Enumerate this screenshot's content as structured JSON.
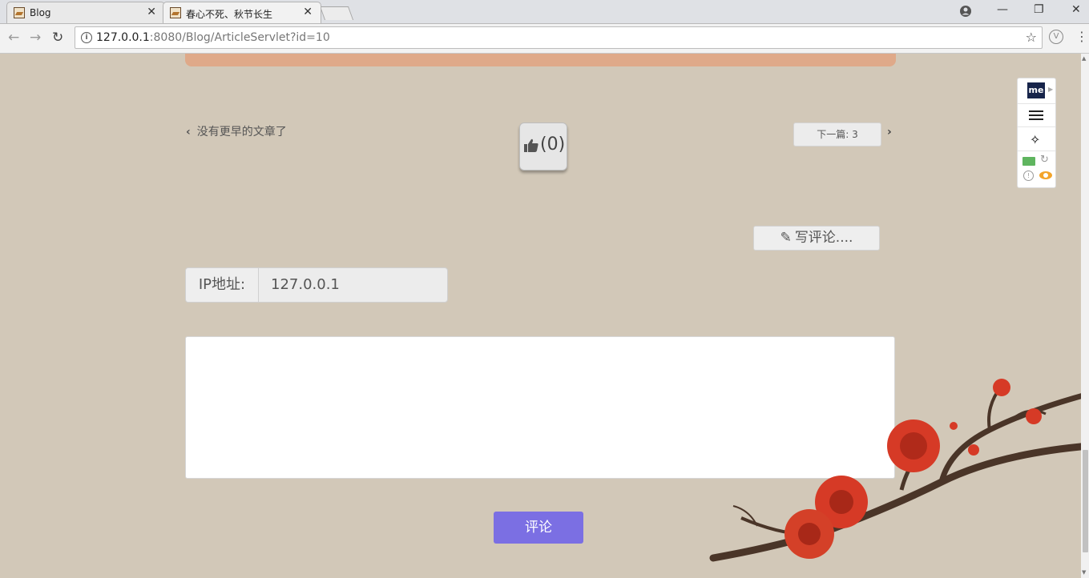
{
  "browser": {
    "tabs": [
      {
        "title": "Blog",
        "active": false
      },
      {
        "title": "春心不死、秋节长生",
        "active": true
      }
    ],
    "url_host": "127.0.0.1",
    "url_rest": ":8080/Blog/ArticleServlet?id=10",
    "window_controls": {
      "minimize": "—",
      "restore": "❐",
      "close": "✕"
    }
  },
  "article_nav": {
    "prev_label": "没有更早的文章了",
    "like_count": "(0)",
    "next_label": "下一篇: 3"
  },
  "comment": {
    "write_label": "写评论....",
    "ip_label": "IP地址:",
    "ip_value": "127.0.0.1",
    "text_value": "",
    "submit_label": "评论"
  },
  "extension_panel": {
    "logo": "me"
  },
  "colors": {
    "page_background": "#d2c8b8",
    "article_bar": "#dfa989",
    "submit_button": "#7b6fe3"
  }
}
